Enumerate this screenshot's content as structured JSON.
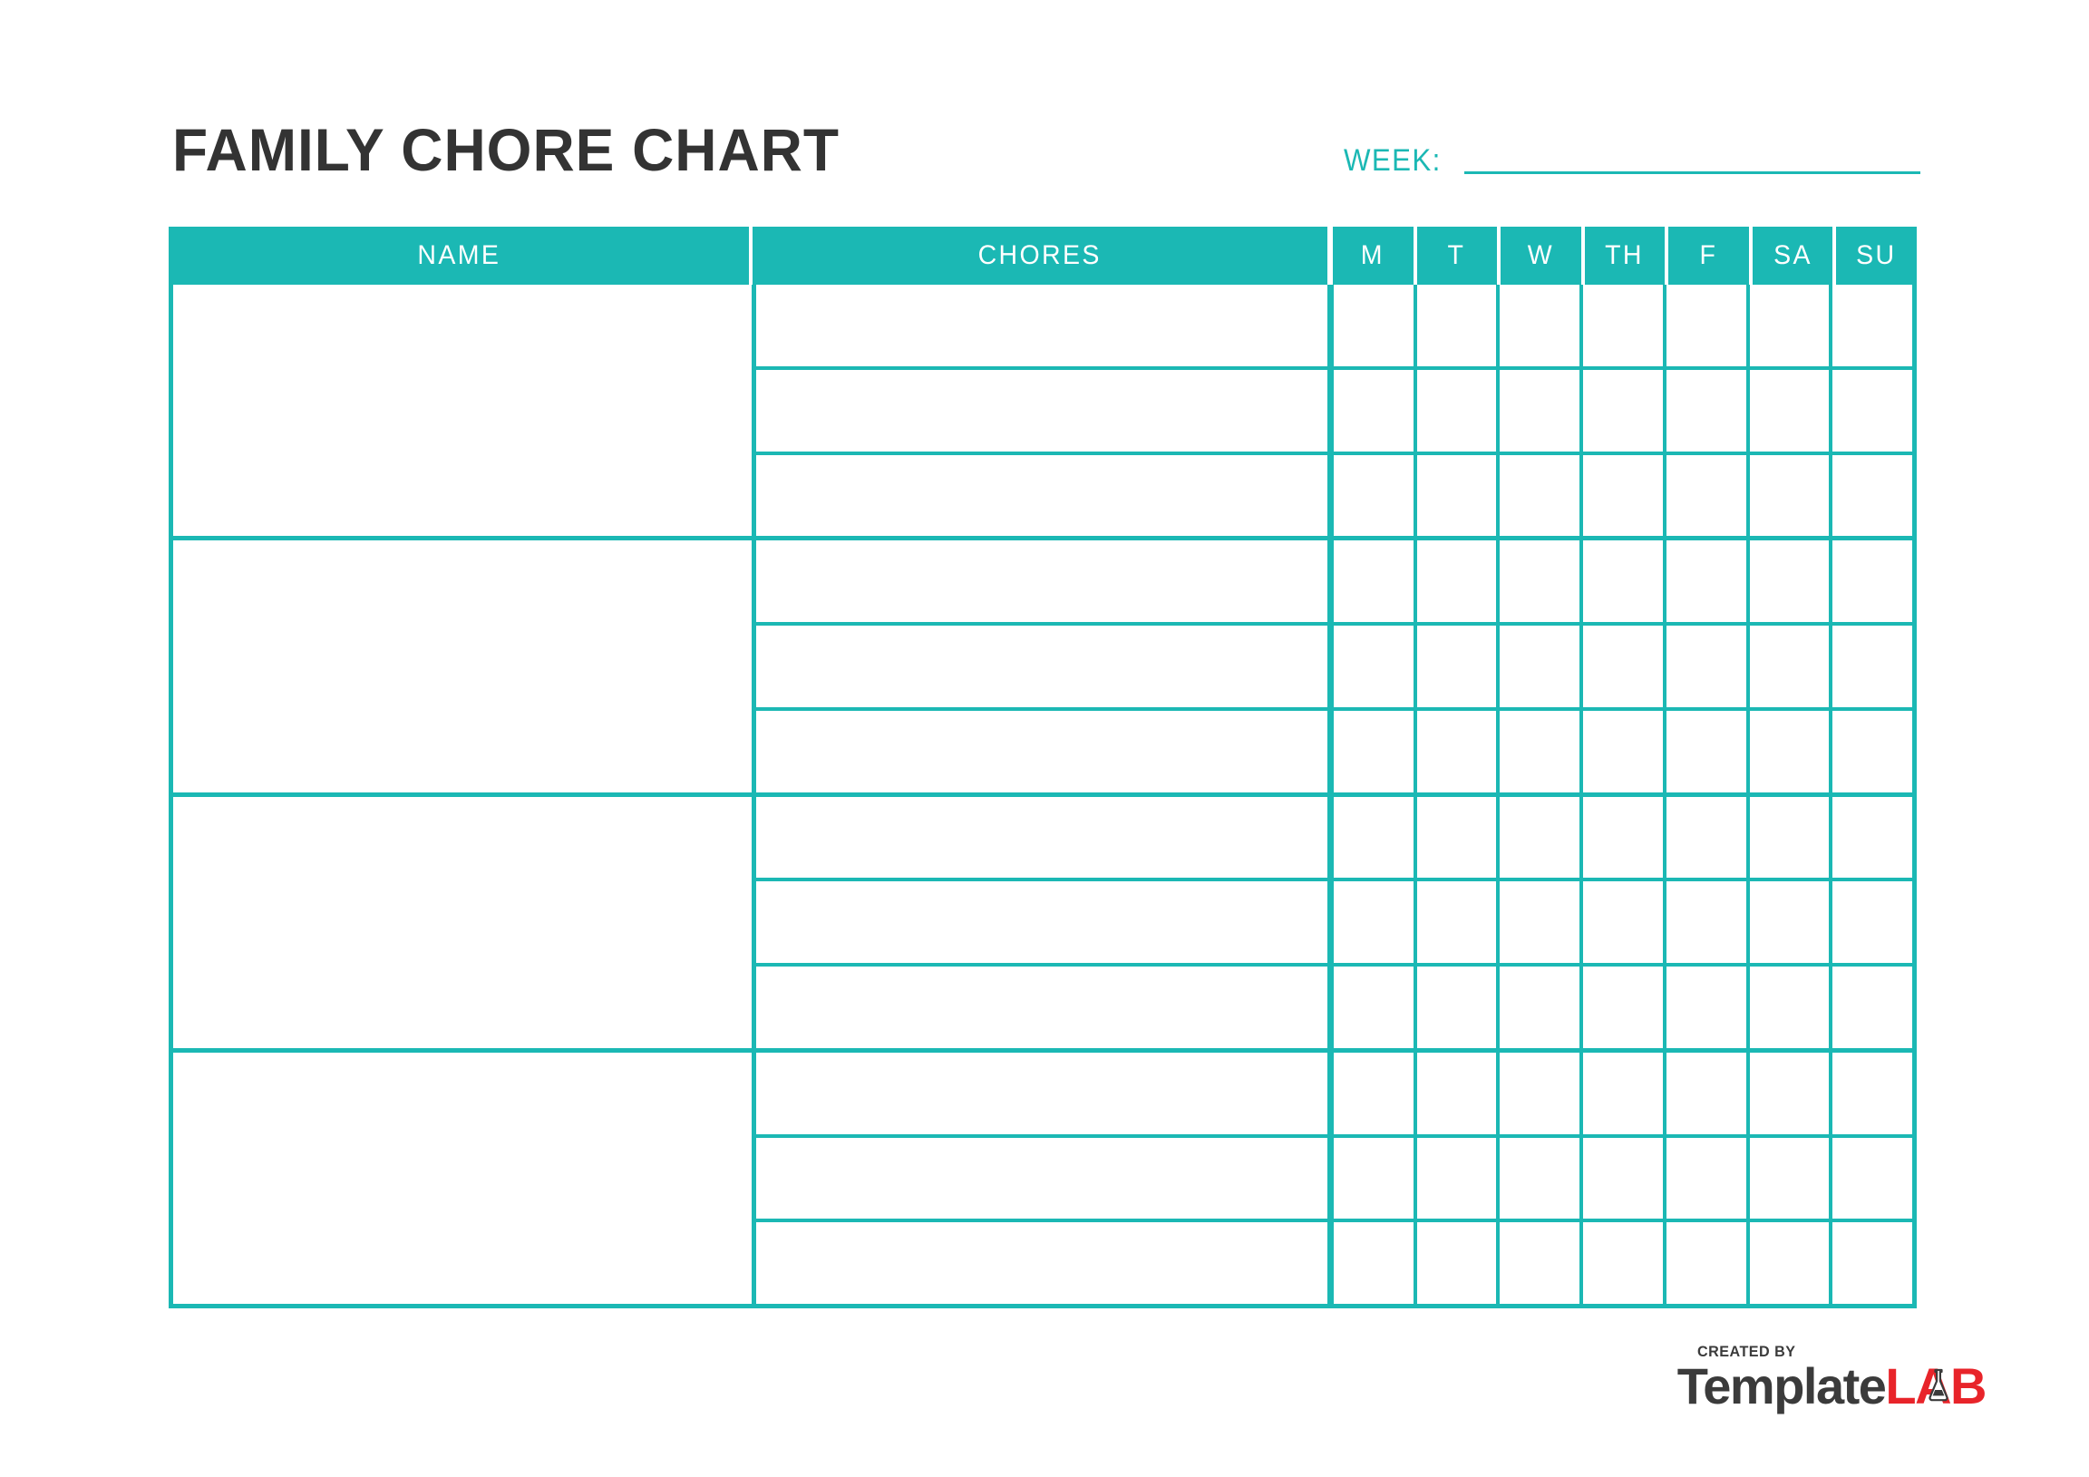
{
  "document": {
    "title": "FAMILY CHORE CHART",
    "accent_color": "#1BB8B4",
    "title_color": "#333333",
    "background_color": "#FFFFFF"
  },
  "week_field": {
    "label": "WEEK:",
    "value": "",
    "placeholder": ""
  },
  "table": {
    "headers": {
      "name": "NAME",
      "chores": "CHORES",
      "days": [
        "M",
        "T",
        "W",
        "TH",
        "F",
        "SA",
        "SU"
      ]
    },
    "groups": [
      {
        "name": "",
        "rows": [
          {
            "chore": "",
            "days": [
              "",
              "",
              "",
              "",
              "",
              "",
              ""
            ]
          },
          {
            "chore": "",
            "days": [
              "",
              "",
              "",
              "",
              "",
              "",
              ""
            ]
          },
          {
            "chore": "",
            "days": [
              "",
              "",
              "",
              "",
              "",
              "",
              ""
            ]
          }
        ]
      },
      {
        "name": "",
        "rows": [
          {
            "chore": "",
            "days": [
              "",
              "",
              "",
              "",
              "",
              "",
              ""
            ]
          },
          {
            "chore": "",
            "days": [
              "",
              "",
              "",
              "",
              "",
              "",
              ""
            ]
          },
          {
            "chore": "",
            "days": [
              "",
              "",
              "",
              "",
              "",
              "",
              ""
            ]
          }
        ]
      },
      {
        "name": "",
        "rows": [
          {
            "chore": "",
            "days": [
              "",
              "",
              "",
              "",
              "",
              "",
              ""
            ]
          },
          {
            "chore": "",
            "days": [
              "",
              "",
              "",
              "",
              "",
              "",
              ""
            ]
          },
          {
            "chore": "",
            "days": [
              "",
              "",
              "",
              "",
              "",
              "",
              ""
            ]
          }
        ]
      },
      {
        "name": "",
        "rows": [
          {
            "chore": "",
            "days": [
              "",
              "",
              "",
              "",
              "",
              "",
              ""
            ]
          },
          {
            "chore": "",
            "days": [
              "",
              "",
              "",
              "",
              "",
              "",
              ""
            ]
          },
          {
            "chore": "",
            "days": [
              "",
              "",
              "",
              "",
              "",
              "",
              ""
            ]
          }
        ]
      }
    ]
  },
  "footer_logo": {
    "created_by": "CREATED BY",
    "brand_first": "Template",
    "brand_second": "LAB",
    "brand_first_color": "#3B3B3B",
    "brand_second_color": "#E8242A",
    "icon": "flask-icon"
  }
}
